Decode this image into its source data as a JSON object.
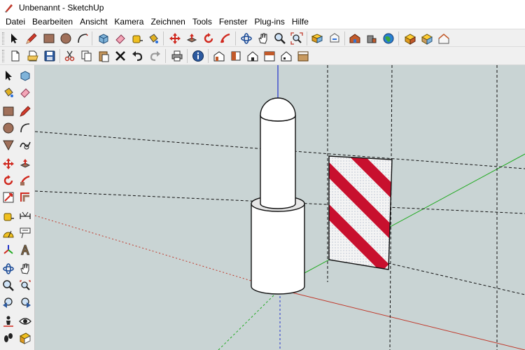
{
  "window": {
    "title": "Unbenannt - SketchUp"
  },
  "menu": {
    "items": [
      "Datei",
      "Bearbeiten",
      "Ansicht",
      "Kamera",
      "Zeichnen",
      "Tools",
      "Fenster",
      "Plug-ins",
      "Hilfe"
    ]
  },
  "colors": {
    "axis_red": "#c0392b",
    "axis_green": "#22aa22",
    "axis_blue": "#2233cc",
    "viewport_bg": "#c9d4d4",
    "stripe_red": "#c8102e"
  },
  "toolbar_row_1": {
    "icons": [
      "select-arrow-icon",
      "pencil-icon",
      "rectangle-icon",
      "circle-icon",
      "arc-icon",
      "eraser-icon",
      "paint-bucket-icon",
      "move-icon",
      "rotate-icon",
      "follow-me-icon",
      "orbit-icon",
      "pan-hand-icon",
      "zoom-icon",
      "zoom-extents-icon",
      "get-models-icon",
      "share-model-icon",
      "warehouse-icon",
      "google-earth-icon",
      "extension-icon",
      "component-icon"
    ]
  },
  "toolbar_row_2": {
    "icons": [
      "new-file-icon",
      "open-folder-icon",
      "save-icon",
      "cut-icon",
      "copy-icon",
      "paste-icon",
      "delete-icon",
      "undo-icon",
      "redo-icon",
      "print-icon",
      "model-info-icon",
      "iso-view-icon",
      "top-view-icon",
      "front-view-icon",
      "right-view-icon",
      "back-view-icon",
      "left-view-icon"
    ]
  },
  "left_toolbar": {
    "icons": [
      "select-arrow-icon",
      "make-component-icon",
      "paint-bucket-icon",
      "eraser-icon",
      "rectangle-icon",
      "line-icon",
      "circle-icon",
      "arc-icon",
      "polygon-icon",
      "freehand-icon",
      "move-icon",
      "push-pull-icon",
      "rotate-icon",
      "follow-me-icon",
      "scale-icon",
      "offset-icon",
      "tape-measure-icon",
      "dimension-icon",
      "protractor-icon",
      "text-icon",
      "axes-icon",
      "3d-text-icon",
      "orbit-icon",
      "pan-icon",
      "zoom-icon",
      "zoom-window-icon",
      "previous-view-icon",
      "next-view-icon",
      "position-camera-icon",
      "look-around-icon",
      "walk-icon",
      "section-plane-icon"
    ]
  }
}
